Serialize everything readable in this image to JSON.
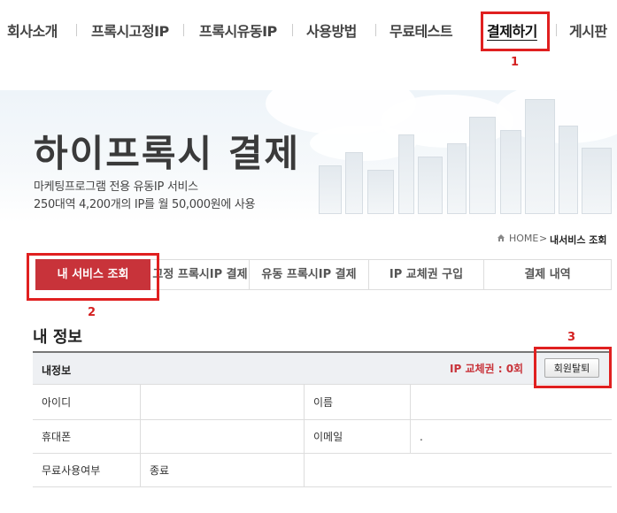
{
  "nav": {
    "items": [
      "회사소개",
      "프록시고정IP",
      "프록시유동IP",
      "사용방법",
      "무료테스트",
      "결제하기",
      "게시판"
    ],
    "active_index": 5
  },
  "annotations": {
    "n1": "1",
    "n2": "2",
    "n3": "3",
    "color": "#e02020"
  },
  "banner": {
    "title": "하이프록시 결제",
    "line1": "마케팅프로그램 전용 유동IP 서비스",
    "line2": "250대역 4,200개의 IP를 월 50,000원에 사용"
  },
  "breadcrumb": {
    "home": "HOME",
    "sep": ">",
    "current": "내서비스 조회"
  },
  "tabs": [
    "내 서비스 조회",
    "고정 프록시IP 결제",
    "유동 프록시IP 결제",
    "IP 교체권 구입",
    "결제 내역"
  ],
  "section": {
    "title": "내 정보",
    "header_label": "내정보",
    "ip_tickets": "IP 교체권 : 0회",
    "withdraw_button": "회원탈퇴"
  },
  "fields": {
    "id_label": "아이디",
    "id_value": "",
    "name_label": "이름",
    "name_value": "",
    "phone_label": "휴대폰",
    "phone_value": "",
    "email_label": "이메일",
    "email_value": ".",
    "free_label": "무료사용여부",
    "free_value": "종료"
  },
  "colors": {
    "accent": "#c8333a",
    "highlight": "#e02020"
  }
}
